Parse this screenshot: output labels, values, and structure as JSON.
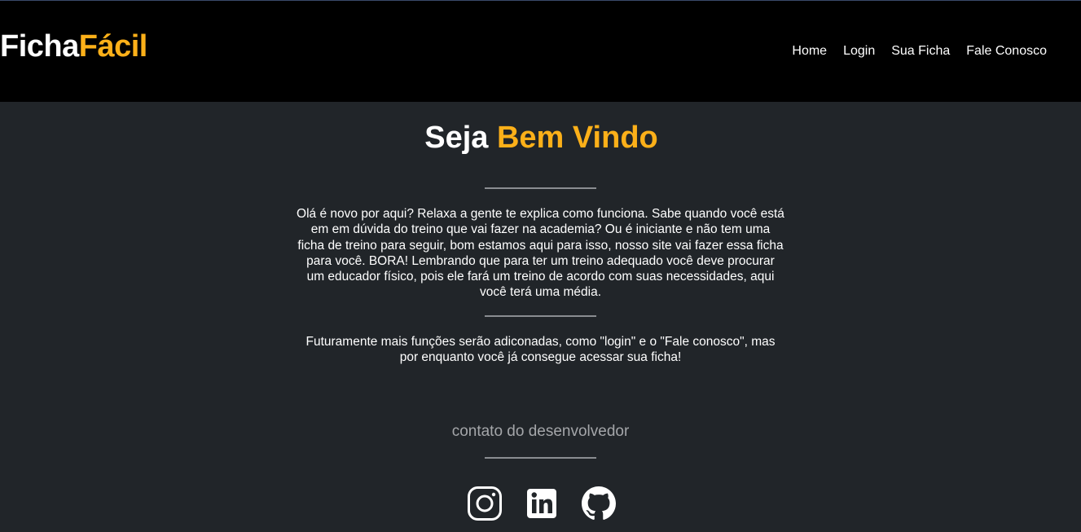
{
  "header": {
    "logo_part1": "Ficha",
    "logo_part2": "Fácil",
    "nav": [
      "Home",
      "Login",
      "Sua Ficha",
      "Fale Conosco"
    ]
  },
  "main": {
    "title_part1": "Seja",
    "title_part2": "Bem Vindo",
    "intro": "Olá é novo por aqui? Relaxa a gente te explica como funciona. Sabe quando você está em em dúvida do treino que vai fazer na academia? Ou é iniciante e não tem uma ficha de treino para seguir, bom estamos aqui para isso, nosso site vai fazer essa ficha para você. BORA! Lembrando que para ter um treino adequado você deve procurar um educador físico, pois ele fará um treino de acordo com suas necessidades, aqui você terá uma média.",
    "future": "Futuramente mais funções serão adiconadas, como \"login\" e o \"Fale conosco\", mas por enquanto você já consegue acessar sua ficha!",
    "contact_label": "contato do desenvolvedor"
  },
  "socials": [
    "instagram-icon",
    "linkedin-icon",
    "github-icon"
  ],
  "colors": {
    "accent": "#fcb019",
    "header_bg": "#000000",
    "page_bg": "#212529",
    "muted_text": "#a4a6a9"
  }
}
